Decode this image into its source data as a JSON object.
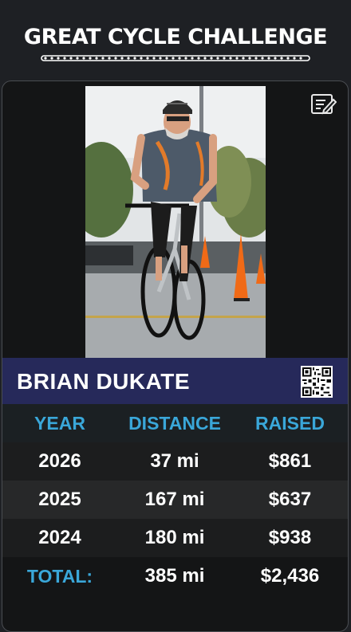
{
  "header": {
    "logo_text": "GREAT CYCLE CHALLENGE"
  },
  "profile": {
    "name": "BRIAN DUKATE"
  },
  "icons": {
    "edit": "edit-note-icon",
    "qr": "qr-code-icon"
  },
  "colors": {
    "accent": "#3aa7d9",
    "name_bar": "#26295a",
    "background": "#1e2024"
  },
  "table": {
    "headers": {
      "year": "YEAR",
      "distance": "DISTANCE",
      "raised": "RAISED"
    },
    "rows": [
      {
        "year": "2026",
        "distance": "37 mi",
        "raised": "$861"
      },
      {
        "year": "2025",
        "distance": "167 mi",
        "raised": "$637"
      },
      {
        "year": "2024",
        "distance": "180 mi",
        "raised": "$938"
      }
    ],
    "total": {
      "label": "TOTAL:",
      "distance": "385 mi",
      "raised": "$2,436"
    }
  }
}
